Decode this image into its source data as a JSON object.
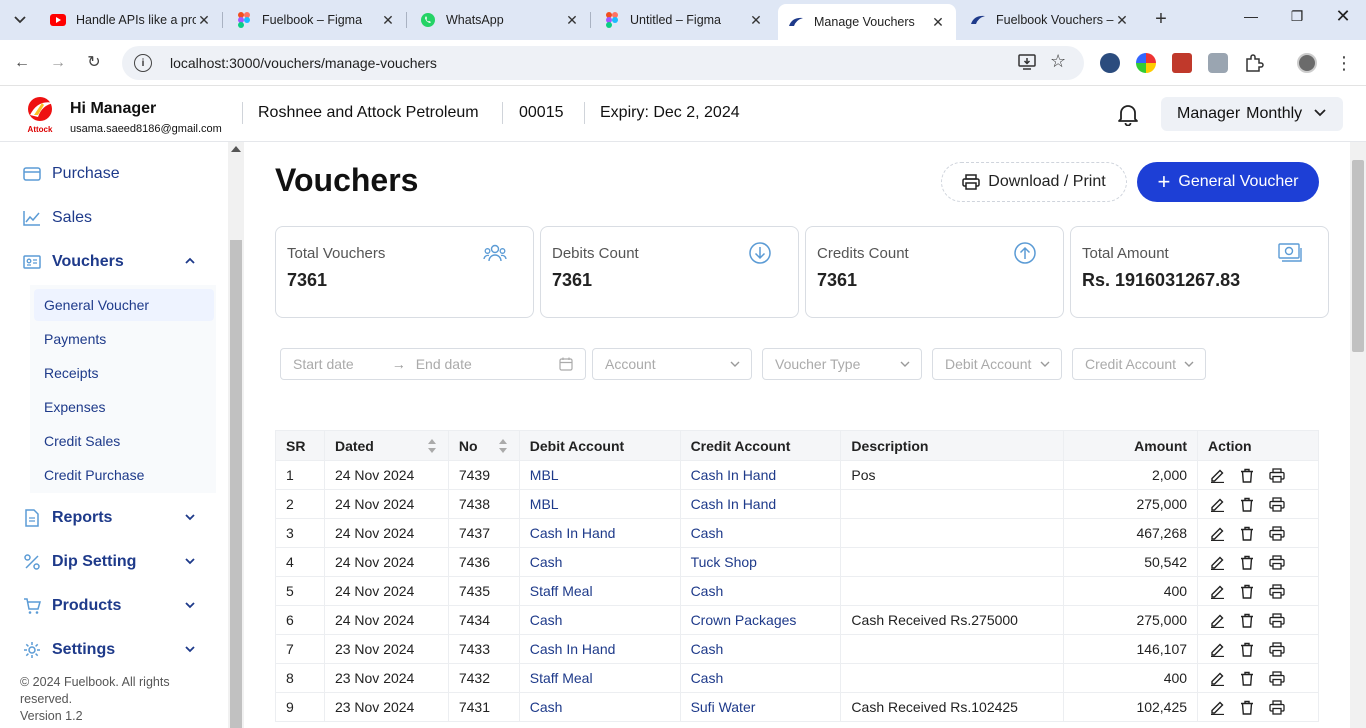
{
  "browser": {
    "tabs": [
      {
        "title": "Handle APIs like a pro",
        "favicon": "youtube-icon"
      },
      {
        "title": "Fuelbook – Figma",
        "favicon": "figma-icon"
      },
      {
        "title": "WhatsApp",
        "favicon": "whatsapp-icon"
      },
      {
        "title": "Untitled – Figma",
        "favicon": "figma-icon"
      },
      {
        "title": "Manage Vouchers",
        "favicon": "app-icon",
        "active": true
      },
      {
        "title": "Fuelbook Vouchers –",
        "favicon": "app-icon"
      }
    ],
    "url": "localhost:3000/vouchers/manage-vouchers"
  },
  "header": {
    "greeting": "Hi Manager",
    "email": "usama.saeed8186@gmail.com",
    "logo_text": "Attock",
    "company": "Roshnee and Attock Petroleum",
    "code": "00015",
    "expiry": "Expiry: Dec 2, 2024",
    "plan_role": "Manager",
    "plan_period": "Monthly"
  },
  "sidebar": {
    "items": [
      {
        "label": "Purchase",
        "icon": "card-icon"
      },
      {
        "label": "Sales",
        "icon": "chart-icon"
      },
      {
        "label": "Vouchers",
        "icon": "voucher-icon",
        "expanded": true
      },
      {
        "label": "Reports",
        "icon": "report-icon"
      },
      {
        "label": "Dip Setting",
        "icon": "percent-icon"
      },
      {
        "label": "Products",
        "icon": "cart-icon"
      },
      {
        "label": "Settings",
        "icon": "gear-icon"
      }
    ],
    "sub_items": [
      "General Voucher",
      "Payments",
      "Receipts",
      "Expenses",
      "Credit Sales",
      "Credit Purchase"
    ],
    "footer_line1": "© 2024 Fuelbook. All rights reserved.",
    "footer_line2": "Version 1.2"
  },
  "main": {
    "title": "Vouchers",
    "download_label": "Download / Print",
    "general_label": "General Voucher",
    "cards": [
      {
        "label": "Total Vouchers",
        "value": "7361",
        "icon": "users-icon"
      },
      {
        "label": "Debits Count",
        "value": "7361",
        "icon": "arrow-down-circle-icon"
      },
      {
        "label": "Credits Count",
        "value": "7361",
        "icon": "arrow-up-circle-icon"
      },
      {
        "label": "Total Amount",
        "value": "Rs. 1916031267.83",
        "icon": "money-icon"
      }
    ],
    "filters": {
      "start_date": "Start date",
      "end_date": "End date",
      "account": "Account",
      "voucher_type": "Voucher Type",
      "debit_account": "Debit Account",
      "credit_account": "Credit Account"
    },
    "table": {
      "headers": [
        "SR",
        "Dated",
        "No",
        "Debit Account",
        "Credit Account",
        "Description",
        "Amount",
        "Action"
      ],
      "rows": [
        [
          "1",
          "24 Nov 2024",
          "7439",
          "MBL",
          "Cash In Hand",
          "Pos",
          "2,000"
        ],
        [
          "2",
          "24 Nov 2024",
          "7438",
          "MBL",
          "Cash In Hand",
          "",
          "275,000"
        ],
        [
          "3",
          "24 Nov 2024",
          "7437",
          "Cash In Hand",
          "Cash",
          "",
          "467,268"
        ],
        [
          "4",
          "24 Nov 2024",
          "7436",
          "Cash",
          "Tuck Shop",
          "",
          "50,542"
        ],
        [
          "5",
          "24 Nov 2024",
          "7435",
          "Staff Meal",
          "Cash",
          "",
          "400"
        ],
        [
          "6",
          "24 Nov 2024",
          "7434",
          "Cash",
          "Crown Packages",
          "Cash Received Rs.275000",
          "275,000"
        ],
        [
          "7",
          "23 Nov 2024",
          "7433",
          "Cash In Hand",
          "Cash",
          "",
          "146,107"
        ],
        [
          "8",
          "23 Nov 2024",
          "7432",
          "Staff Meal",
          "Cash",
          "",
          "400"
        ],
        [
          "9",
          "23 Nov 2024",
          "7431",
          "Cash",
          "Sufi Water",
          "Cash Received Rs.102425",
          "102,425"
        ]
      ]
    }
  },
  "colors": {
    "primary": "#1d3fd6",
    "link": "#1e3a8a",
    "icon_blue": "#5b9bd5"
  }
}
